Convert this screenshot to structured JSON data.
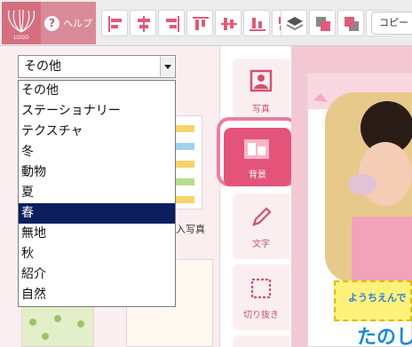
{
  "toolbar": {
    "help_label": "ヘルプ",
    "copy_label": "コピー",
    "align_tools": [
      "align-left-icon",
      "align-center-h-icon",
      "align-right-icon",
      "align-top-icon",
      "align-center-v-icon",
      "align-bottom-icon",
      "distribute-icon"
    ],
    "layer_tools": [
      "bring-front-icon",
      "bring-forward-icon",
      "send-backward-icon",
      "send-back-icon"
    ]
  },
  "category_select": {
    "value": "その他",
    "options": [
      "その他",
      "ステーショナリー",
      "テクスチャ",
      "冬",
      "動物",
      "夏",
      "春",
      "無地",
      "秋",
      "紹介",
      "自然"
    ],
    "highlighted": "春"
  },
  "thumbnails": {
    "partial_label": "入写真"
  },
  "side_tabs": [
    {
      "label": "写真",
      "icon": "photo-icon"
    },
    {
      "label": "背景",
      "icon": "background-icon",
      "active": true
    },
    {
      "label": "文字",
      "icon": "pencil-icon"
    },
    {
      "label": "切り抜き",
      "icon": "crop-frame-icon"
    }
  ],
  "preview": {
    "banner_text": "ようちえんで",
    "big_text": "たのし"
  },
  "colors": {
    "brand": "#d46f80",
    "accent": "#e4547a",
    "selection": "#0b1f5f"
  }
}
